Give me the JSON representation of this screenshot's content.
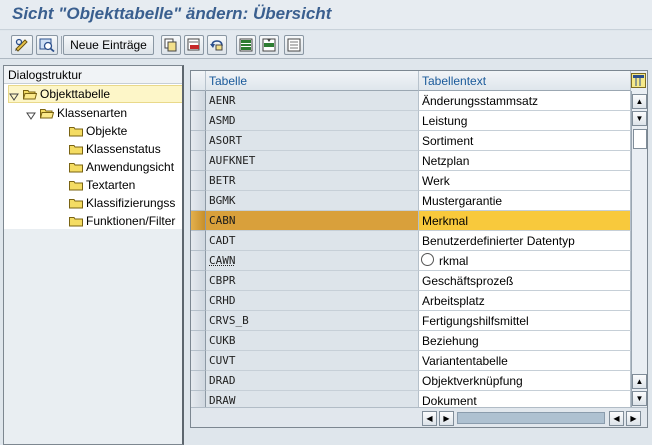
{
  "window": {
    "title": "Sicht \"Objekttabelle\" ändern: Übersicht"
  },
  "toolbar": {
    "new_entries_label": "Neue Einträge",
    "icons": [
      "display-change-icon",
      "details-icon",
      "new-entries-button",
      "copy-icon",
      "delete-icon",
      "undo-icon",
      "select-all-icon",
      "select-block-icon",
      "deselect-all-icon"
    ]
  },
  "tree": {
    "header": "Dialogstruktur",
    "nodes": [
      {
        "label": "Objekttabelle",
        "level": 0,
        "expanded": true,
        "selected": true
      },
      {
        "label": "Klassenarten",
        "level": 1,
        "expanded": true,
        "selected": false
      },
      {
        "label": "Objekte",
        "level": 2,
        "expanded": false,
        "selected": false
      },
      {
        "label": "Klassenstatus",
        "level": 2,
        "expanded": false,
        "selected": false
      },
      {
        "label": "Anwendungsicht",
        "level": 2,
        "expanded": false,
        "selected": false
      },
      {
        "label": "Textarten",
        "level": 2,
        "expanded": false,
        "selected": false
      },
      {
        "label": "Klassifizierungss",
        "level": 2,
        "expanded": false,
        "selected": false
      },
      {
        "label": "Funktionen/Filter",
        "level": 2,
        "expanded": false,
        "selected": false
      }
    ]
  },
  "table": {
    "columns": [
      "Tabelle",
      "Tabellentext"
    ],
    "rows": [
      {
        "key": "AENR",
        "text": "Änderungsstammsatz"
      },
      {
        "key": "ASMD",
        "text": "Leistung"
      },
      {
        "key": "ASORT",
        "text": "Sortiment"
      },
      {
        "key": "AUFKNET",
        "text": "Netzplan"
      },
      {
        "key": "BETR",
        "text": "Werk"
      },
      {
        "key": "BGMK",
        "text": "Mustergarantie"
      },
      {
        "key": "CABN",
        "text": "Merkmal",
        "selected": true
      },
      {
        "key": "CADT",
        "text": "Benutzerdefinierter Datentyp"
      },
      {
        "key": "CAWN",
        "text": "rkmal"
      },
      {
        "key": "CBPR",
        "text": "Geschäftsprozeß"
      },
      {
        "key": "CRHD",
        "text": "Arbeitsplatz"
      },
      {
        "key": "CRVS_B",
        "text": "Fertigungshilfsmittel"
      },
      {
        "key": "CUKB",
        "text": "Beziehung"
      },
      {
        "key": "CUVT",
        "text": "Variantentabelle"
      },
      {
        "key": "DRAD",
        "text": "Objektverknüpfung"
      },
      {
        "key": "DRAW",
        "text": "Dokument"
      }
    ]
  },
  "colors": {
    "title": "#3a5f8f",
    "selected_row": "#f8c93c",
    "header_text": "#1a5a9a"
  }
}
